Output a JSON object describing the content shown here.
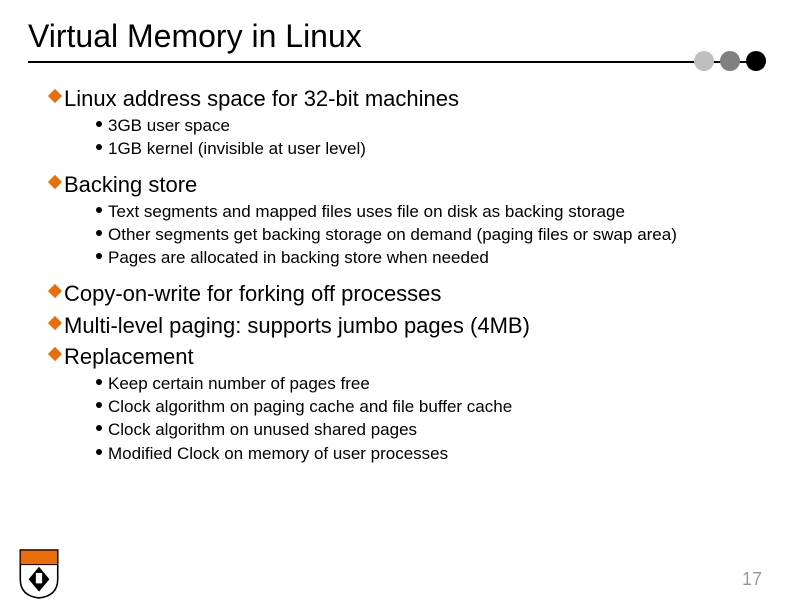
{
  "title": "Virtual Memory in Linux",
  "page_number": "17",
  "colors": {
    "accent": "#e86e0a"
  },
  "sections": [
    {
      "heading": "Linux address space for 32-bit machines",
      "items": [
        "3GB user space",
        "1GB kernel (invisible at user level)"
      ]
    },
    {
      "heading": "Backing store",
      "items": [
        "Text segments and mapped files uses file on disk as backing storage",
        "Other segments get backing storage on demand (paging files or swap area)",
        "Pages are allocated in backing store when needed"
      ]
    },
    {
      "heading": "Copy-on-write for forking off processes",
      "items": []
    },
    {
      "heading": "Multi-level paging: supports jumbo pages (4MB)",
      "items": []
    },
    {
      "heading": "Replacement",
      "items": [
        "Keep certain number of pages free",
        "Clock algorithm on paging cache and file buffer cache",
        "Clock algorithm on unused shared pages",
        "Modified Clock on memory of user processes"
      ]
    }
  ]
}
